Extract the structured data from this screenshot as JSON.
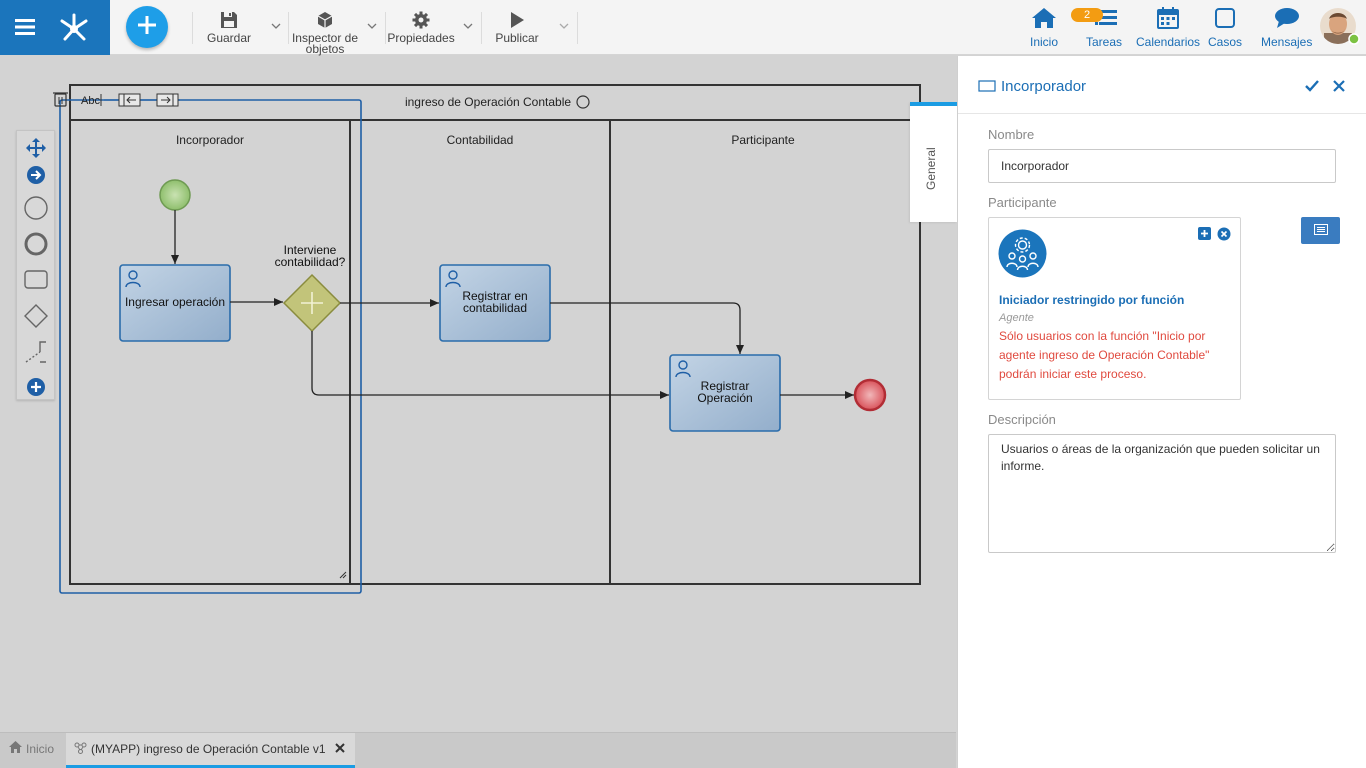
{
  "toolbar": {
    "guardar": "Guardar",
    "inspector_line1": "Inspector de",
    "inspector_line2": "objetos",
    "propiedades": "Propiedades",
    "publicar": "Publicar"
  },
  "nav": {
    "inicio": "Inicio",
    "tareas": "Tareas",
    "tareas_badge": "2",
    "calendarios": "Calendarios",
    "casos": "Casos",
    "mensajes": "Mensajes"
  },
  "diagram": {
    "edit_label": "Abc",
    "pool_title": "ingreso de Operación Contable",
    "lanes": [
      "Incorporador",
      "Contabilidad",
      "Participante"
    ],
    "task_ingresar": "Ingresar operación",
    "gateway_label_1": "Interviene",
    "gateway_label_2": "contabilidad?",
    "task_registrar_cont_1": "Registrar en",
    "task_registrar_cont_2": "contabilidad",
    "task_registrar_op_1": "Registrar",
    "task_registrar_op_2": "Operación"
  },
  "bottom_tabs": {
    "home": "Inicio",
    "active": "(MYAPP) ingreso de Operación Contable v1"
  },
  "panel": {
    "tab_general": "General",
    "title": "Incorporador",
    "nombre_label": "Nombre",
    "nombre_value": "Incorporador",
    "participante_label": "Participante",
    "participant_name": "Iniciador restringido por función",
    "participant_type": "Agente",
    "participant_warning": "Sólo usuarios con la función \"Inicio por agente ingreso de Operación Contable\" podrán iniciar este proceso.",
    "descripcion_label": "Descripción",
    "descripcion_value": "Usuarios o áreas de la organización que pueden solicitar un informe."
  },
  "colors": {
    "brand_blue": "#1b75bc",
    "add_button": "#1e9ee8",
    "task_fill": "#a9c1d8",
    "task_border": "#2a6cab",
    "start_event": "#8fbf6d",
    "end_event": "#d9535b",
    "gateway": "#c2c47a",
    "warning_red": "#e04a3f",
    "link_blue": "#1b6eb5",
    "badge_orange": "#f39c12"
  }
}
